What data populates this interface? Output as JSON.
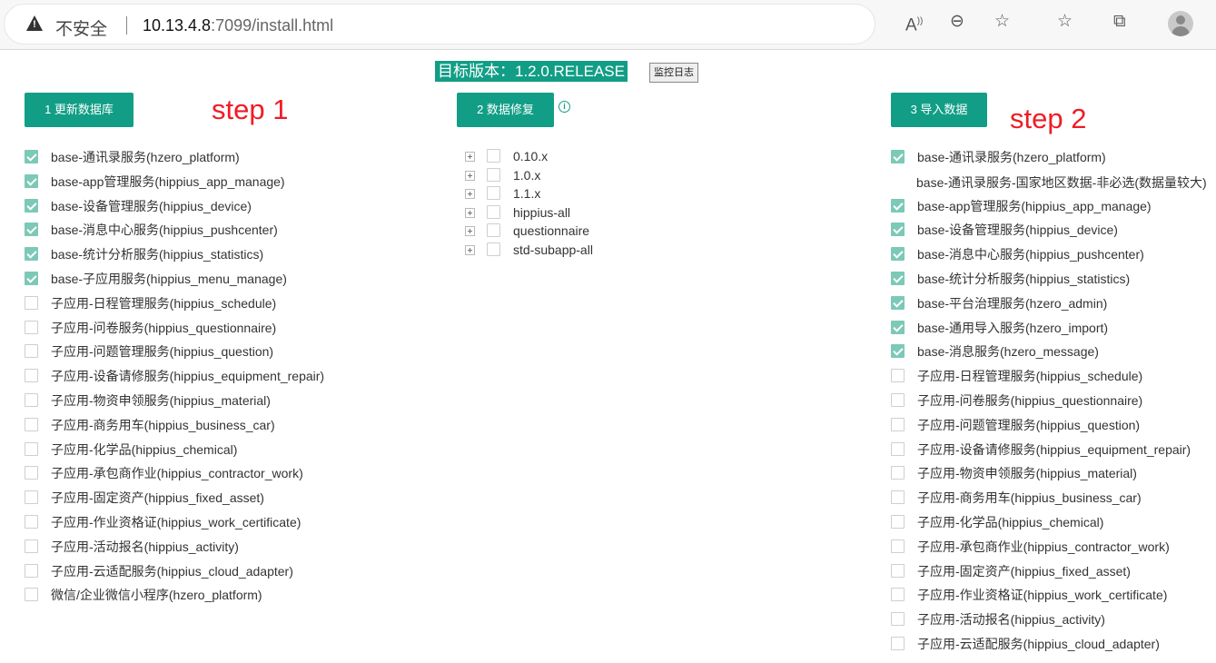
{
  "browser": {
    "insecure_label": "不安全",
    "url_host": "10.13.4.8",
    "url_port_path": ":7099/install.html"
  },
  "page": {
    "target_version": "目标版本：1.2.0.RELEASE",
    "monitor_log_button": "监控日志",
    "update_db_button": "1 更新数据库",
    "data_repair_button": "2 数据修复",
    "import_data_button": "3 导入数据",
    "step1": "step 1",
    "step2": "step 2"
  },
  "update_db_items": [
    {
      "label": "base-通讯录服务(hzero_platform)",
      "checked": true
    },
    {
      "label": "base-app管理服务(hippius_app_manage)",
      "checked": true
    },
    {
      "label": "base-设备管理服务(hippius_device)",
      "checked": true
    },
    {
      "label": "base-消息中心服务(hippius_pushcenter)",
      "checked": true
    },
    {
      "label": "base-统计分析服务(hippius_statistics)",
      "checked": true
    },
    {
      "label": "base-子应用服务(hippius_menu_manage)",
      "checked": true
    },
    {
      "label": "子应用-日程管理服务(hippius_schedule)",
      "checked": false
    },
    {
      "label": "子应用-问卷服务(hippius_questionnaire)",
      "checked": false
    },
    {
      "label": "子应用-问题管理服务(hippius_question)",
      "checked": false
    },
    {
      "label": "子应用-设备请修服务(hippius_equipment_repair)",
      "checked": false
    },
    {
      "label": "子应用-物资申领服务(hippius_material)",
      "checked": false
    },
    {
      "label": "子应用-商务用车(hippius_business_car)",
      "checked": false
    },
    {
      "label": "子应用-化学品(hippius_chemical)",
      "checked": false
    },
    {
      "label": "子应用-承包商作业(hippius_contractor_work)",
      "checked": false
    },
    {
      "label": "子应用-固定资产(hippius_fixed_asset)",
      "checked": false
    },
    {
      "label": "子应用-作业资格证(hippius_work_certificate)",
      "checked": false
    },
    {
      "label": "子应用-活动报名(hippius_activity)",
      "checked": false
    },
    {
      "label": "子应用-云适配服务(hippius_cloud_adapter)",
      "checked": false
    },
    {
      "label": "微信/企业微信小程序(hzero_platform)",
      "checked": false
    }
  ],
  "repair_tree": [
    {
      "label": "0.10.x",
      "checked": false
    },
    {
      "label": "1.0.x",
      "checked": false
    },
    {
      "label": "1.1.x",
      "checked": false
    },
    {
      "label": "hippius-all",
      "checked": false
    },
    {
      "label": "questionnaire",
      "checked": false
    },
    {
      "label": "std-subapp-all",
      "checked": false
    }
  ],
  "import_special_label": "base-通讯录服务-国家地区数据-非必选(数据量较大)",
  "import_items": [
    {
      "label": "base-通讯录服务(hzero_platform)",
      "checked": true
    },
    {
      "label": "base-app管理服务(hippius_app_manage)",
      "checked": true
    },
    {
      "label": "base-设备管理服务(hippius_device)",
      "checked": true
    },
    {
      "label": "base-消息中心服务(hippius_pushcenter)",
      "checked": true
    },
    {
      "label": "base-统计分析服务(hippius_statistics)",
      "checked": true
    },
    {
      "label": "base-平台治理服务(hzero_admin)",
      "checked": true
    },
    {
      "label": "base-通用导入服务(hzero_import)",
      "checked": true
    },
    {
      "label": "base-消息服务(hzero_message)",
      "checked": true
    },
    {
      "label": "子应用-日程管理服务(hippius_schedule)",
      "checked": false
    },
    {
      "label": "子应用-问卷服务(hippius_questionnaire)",
      "checked": false
    },
    {
      "label": "子应用-问题管理服务(hippius_question)",
      "checked": false
    },
    {
      "label": "子应用-设备请修服务(hippius_equipment_repair)",
      "checked": false
    },
    {
      "label": "子应用-物资申领服务(hippius_material)",
      "checked": false
    },
    {
      "label": "子应用-商务用车(hippius_business_car)",
      "checked": false
    },
    {
      "label": "子应用-化学品(hippius_chemical)",
      "checked": false
    },
    {
      "label": "子应用-承包商作业(hippius_contractor_work)",
      "checked": false
    },
    {
      "label": "子应用-固定资产(hippius_fixed_asset)",
      "checked": false
    },
    {
      "label": "子应用-作业资格证(hippius_work_certificate)",
      "checked": false
    },
    {
      "label": "子应用-活动报名(hippius_activity)",
      "checked": false
    },
    {
      "label": "子应用-云适配服务(hippius_cloud_adapter)",
      "checked": false
    }
  ]
}
